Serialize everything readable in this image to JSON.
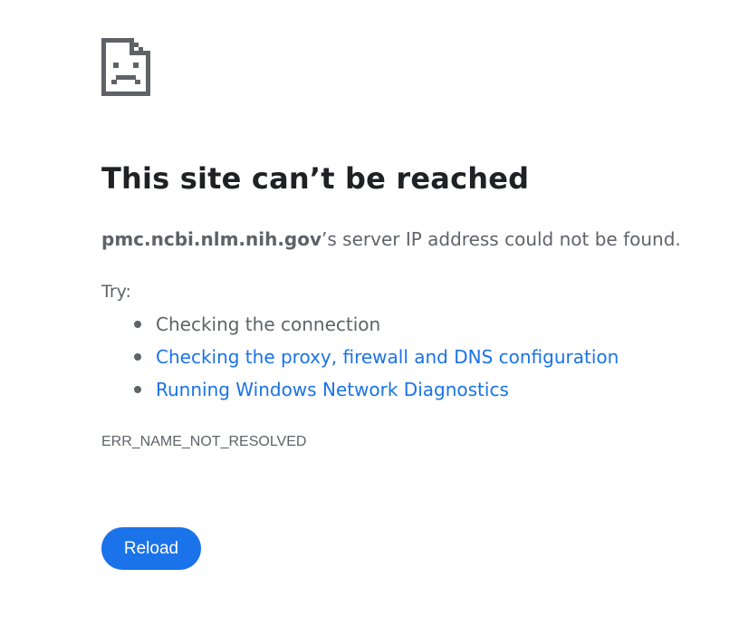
{
  "error_page": {
    "icon": "sad-page-icon",
    "title": "This site can’t be reached",
    "host": "pmc.ncbi.nlm.nih.gov",
    "message_suffix": "’s server IP address could not be found.",
    "try_label": "Try:",
    "suggestions": [
      {
        "label": "Checking the connection",
        "is_link": false
      },
      {
        "label": "Checking the proxy, firewall and DNS configuration",
        "is_link": true
      },
      {
        "label": "Running Windows Network Diagnostics",
        "is_link": true
      }
    ],
    "error_code": "ERR_NAME_NOT_RESOLVED",
    "reload_label": "Reload"
  },
  "colors": {
    "title": "#202124",
    "text": "#5f6368",
    "link": "#1a73e8",
    "button_bg": "#1a73e8",
    "button_text": "#ffffff",
    "icon": "#5f6368"
  }
}
